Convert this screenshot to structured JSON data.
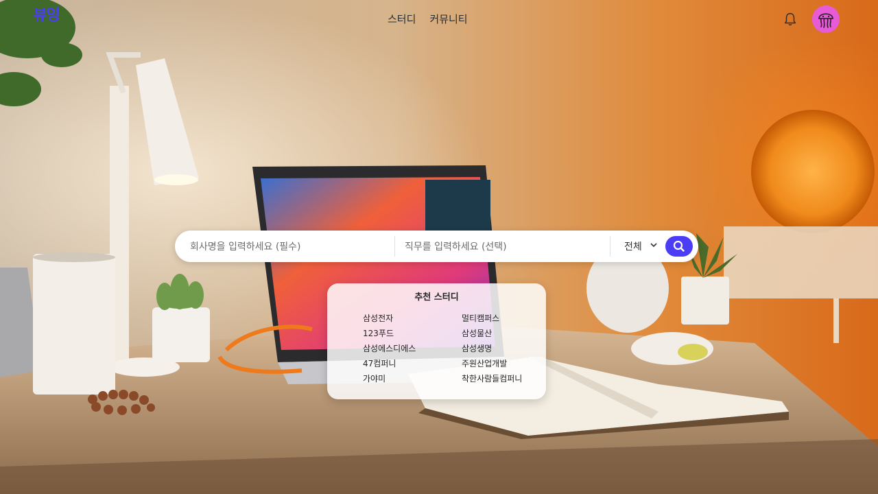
{
  "header": {
    "logo": "뷰잉",
    "nav": [
      "스터디",
      "커뮤니티"
    ]
  },
  "icons": {
    "bell": "bell-icon",
    "avatar": "jellyfish-avatar-icon",
    "search": "search-icon",
    "chevron": "chevron-down-icon"
  },
  "search": {
    "company_placeholder": "회사명을 입력하세요 (필수)",
    "company_value": "",
    "job_placeholder": "직무를 입력하세요 (선택)",
    "job_value": "",
    "scope_selected": "전체"
  },
  "recommend": {
    "title": "추천 스터디",
    "left": [
      "삼성전자",
      "123푸드",
      "삼성에스디에스",
      "47컴퍼니",
      "가야미"
    ],
    "right": [
      "멀티캠퍼스",
      "삼성물산",
      "삼성생명",
      "주원산업개발",
      "착한사람들컴퍼니"
    ]
  },
  "colors": {
    "accent": "#4b3cf5",
    "avatar_bg": "#e85bd6"
  }
}
